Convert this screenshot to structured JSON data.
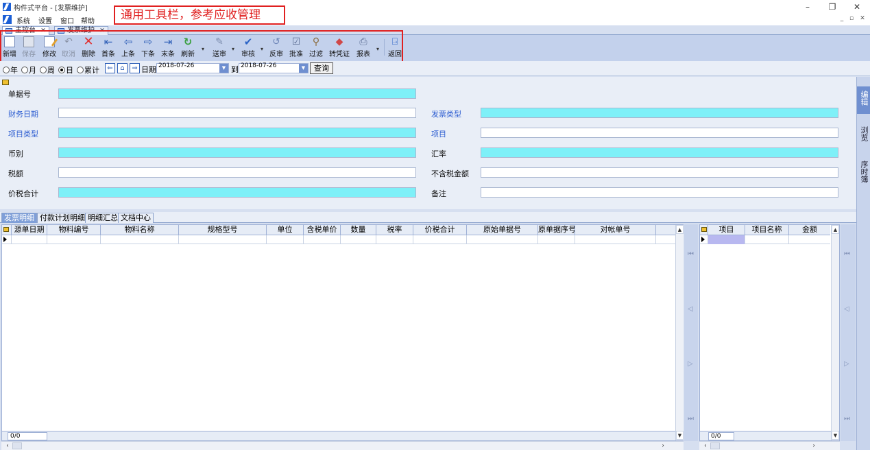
{
  "window": {
    "title": "构件式平台 - [发票维护]",
    "minimize_glyph": "–",
    "restore_glyph": "❐",
    "close_glyph": "✕"
  },
  "menu": {
    "items": [
      "系统",
      "设置",
      "窗口",
      "帮助"
    ],
    "mdi_controls": [
      "_",
      "▫",
      "✕"
    ]
  },
  "annotation": {
    "text": "通用工具栏，参考应收管理",
    "color": "#e02020"
  },
  "doc_tabs": [
    {
      "label": "主控台",
      "close": "✕"
    },
    {
      "label": "发票维护",
      "close": "✕"
    }
  ],
  "toolbar": {
    "new_label": "新增",
    "save_label": "保存",
    "edit_label": "修改",
    "cancel_label": "取消",
    "delete_label": "删除",
    "first_label": "首条",
    "prev_label": "上条",
    "next_label": "下条",
    "last_label": "末条",
    "refresh_label": "刷新",
    "submit_label": "送审",
    "audit_label": "审核",
    "unaudit_label": "反审",
    "approve_label": "批准",
    "filter_label": "过滤",
    "voucher_label": "转凭证",
    "report_label": "报表",
    "return_label": "返回"
  },
  "filter": {
    "period_options": [
      "年",
      "月",
      "周",
      "日",
      "累计"
    ],
    "selected_period": "日",
    "date_label": "日期",
    "date_from": "2018-07-26",
    "to_label": "到",
    "date_to": "2018-07-26",
    "query_label": "查询"
  },
  "form": {
    "doc_no_label": "单据号",
    "fin_date_label": "财务日期",
    "invoice_type_label": "发票类型",
    "item_type_label": "项目类型",
    "item_label": "项目",
    "currency_label": "币别",
    "rate_label": "汇率",
    "tax_label": "税额",
    "amount_ex_tax_label": "不含税金额",
    "total_label": "价税合计",
    "remark_label": "备注"
  },
  "side_tabs": [
    "编辑",
    "浏览",
    "序时簿"
  ],
  "sub_tabs": [
    "发票明细",
    "付款计划明细",
    "明细汇总",
    "文档中心"
  ],
  "main_grid": {
    "columns": [
      "源单日期",
      "物料编号",
      "物料名称",
      "规格型号",
      "单位",
      "含税单价",
      "数量",
      "税率",
      "价税合计",
      "原始单据号",
      "原单据序号",
      "对帐单号"
    ],
    "record_count": "0/0"
  },
  "side_grid": {
    "columns": [
      "项目",
      "项目名称",
      "金额"
    ],
    "record_count": "0/0"
  },
  "colors": {
    "accent": "#6f8fd0",
    "required_field": "#7ef0f8",
    "link_label": "#2a5bd0"
  }
}
